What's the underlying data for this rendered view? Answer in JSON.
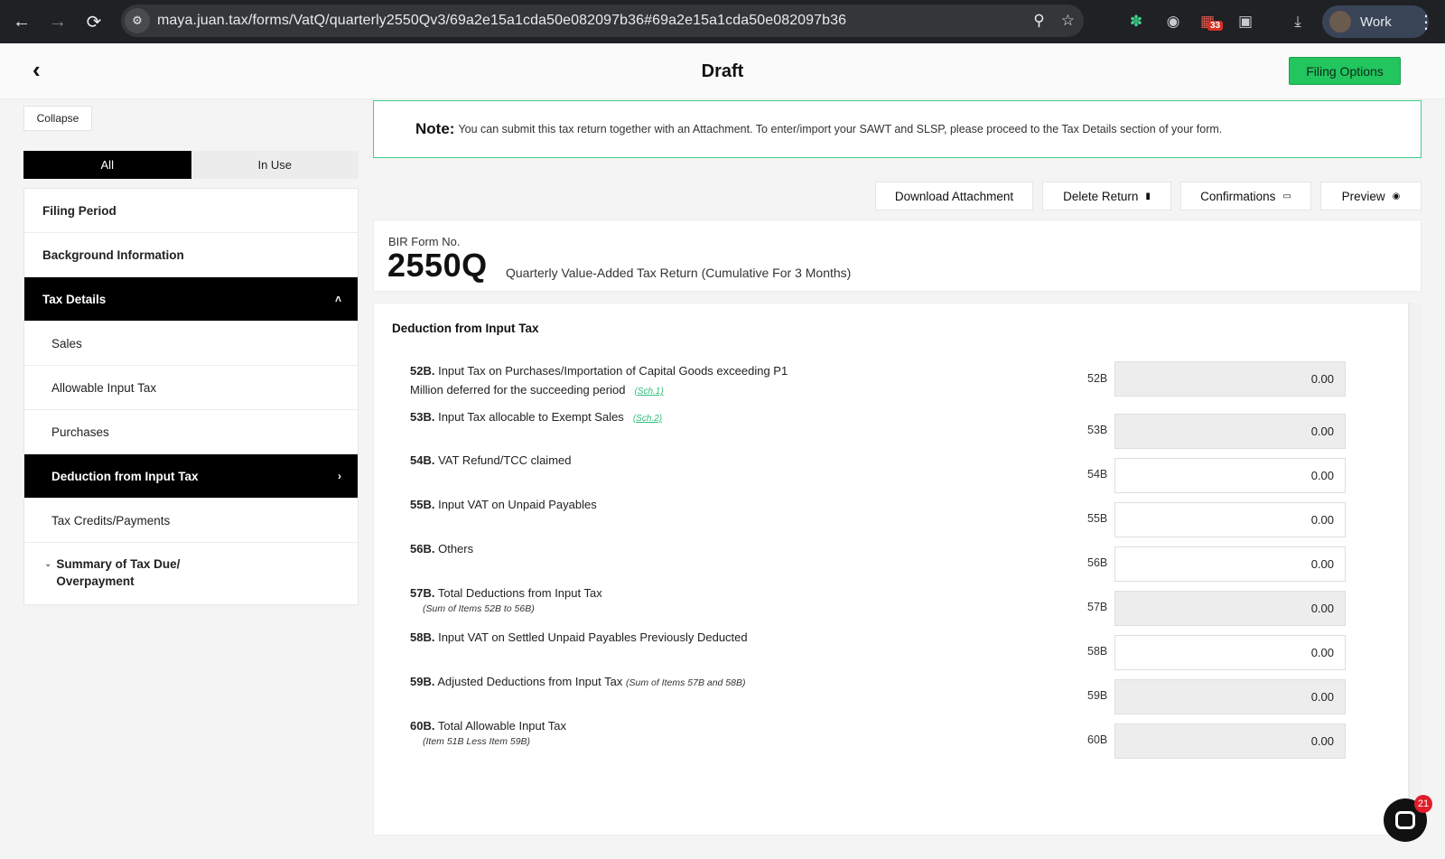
{
  "browser": {
    "url": "maya.juan.tax/forms/VatQ/quarterly2550Qv3/69a2e15a1cda50e082097b36#69a2e15a1cda50e082097b36",
    "profile_name": "Work",
    "extension_badge": "33",
    "icons": [
      "back-arrow-icon",
      "forward-arrow-icon",
      "reload-icon",
      "site-settings-icon",
      "zoom-icon",
      "star-icon",
      "chatgpt-icon",
      "camera-icon",
      "calendar-extension-icon",
      "puzzle-icon",
      "download-icon",
      "more-vert-icon"
    ]
  },
  "header": {
    "title": "Draft",
    "filing_options": "Filing Options"
  },
  "sidebar": {
    "collapse": "Collapse",
    "segments": [
      "All",
      "In Use"
    ],
    "items": [
      {
        "label": "Filing Period"
      },
      {
        "label": "Background Information"
      },
      {
        "label": "Tax Details"
      },
      {
        "label": "Sales"
      },
      {
        "label": "Allowable Input Tax"
      },
      {
        "label": "Purchases"
      },
      {
        "label": "Deduction from Input Tax"
      },
      {
        "label": "Tax Credits/Payments"
      },
      {
        "label_line1": "Summary of Tax Due/",
        "label_line2": "Overpayment"
      }
    ]
  },
  "note": {
    "title": "Note:",
    "text": "You can submit this tax return together with an Attachment. To enter/import your SAWT and SLSP, please proceed to the Tax Details section of your form."
  },
  "actions": {
    "download": "Download Attachment",
    "delete": "Delete Return",
    "confirmations": "Confirmations",
    "preview": "Preview"
  },
  "form": {
    "bir_label": "BIR Form No.",
    "number": "2550Q",
    "description": "Quarterly Value-Added Tax Return (Cumulative For 3 Months)"
  },
  "section": {
    "title": "Deduction from Input Tax",
    "rows": [
      {
        "num": "52B.",
        "text": "Input Tax on Purchases/Importation of Capital Goods exceeding P1",
        "text2": "Million deferred for the succeeding period",
        "link": "(Sch.1)",
        "code": "52B",
        "value": "0.00",
        "readonly": true
      },
      {
        "num": "53B.",
        "text": "Input Tax allocable to Exempt Sales",
        "link": "(Sch.2)",
        "code": "53B",
        "value": "0.00",
        "readonly": true
      },
      {
        "num": "54B.",
        "text": "VAT Refund/TCC claimed",
        "code": "54B",
        "value": "0.00",
        "readonly": false
      },
      {
        "num": "55B.",
        "text": "Input VAT on Unpaid Payables",
        "code": "55B",
        "value": "0.00",
        "readonly": false
      },
      {
        "num": "56B.",
        "text": "Others",
        "code": "56B",
        "value": "0.00",
        "readonly": false
      },
      {
        "num": "57B.",
        "text": "Total Deductions from Input Tax",
        "sub": "(Sum of Items 52B to 56B)",
        "code": "57B",
        "value": "0.00",
        "readonly": true
      },
      {
        "num": "58B.",
        "text": "Input VAT on Settled Unpaid Payables Previously Deducted",
        "code": "58B",
        "value": "0.00",
        "readonly": false
      },
      {
        "num": "59B.",
        "text": "Adjusted Deductions from Input Tax",
        "inline_sub": "(Sum of Items 57B and 58B)",
        "code": "59B",
        "value": "0.00",
        "readonly": true
      },
      {
        "num": "60B.",
        "text": "Total Allowable Input Tax",
        "sub": "(Item 51B Less Item 59B)",
        "code": "60B",
        "value": "0.00",
        "readonly": true
      }
    ]
  },
  "chat": {
    "badge": "21"
  },
  "colors": {
    "accent_green": "#22c55e",
    "note_border": "#3fd08a",
    "active_bg": "#000000",
    "badge_red": "#e11d2a"
  }
}
